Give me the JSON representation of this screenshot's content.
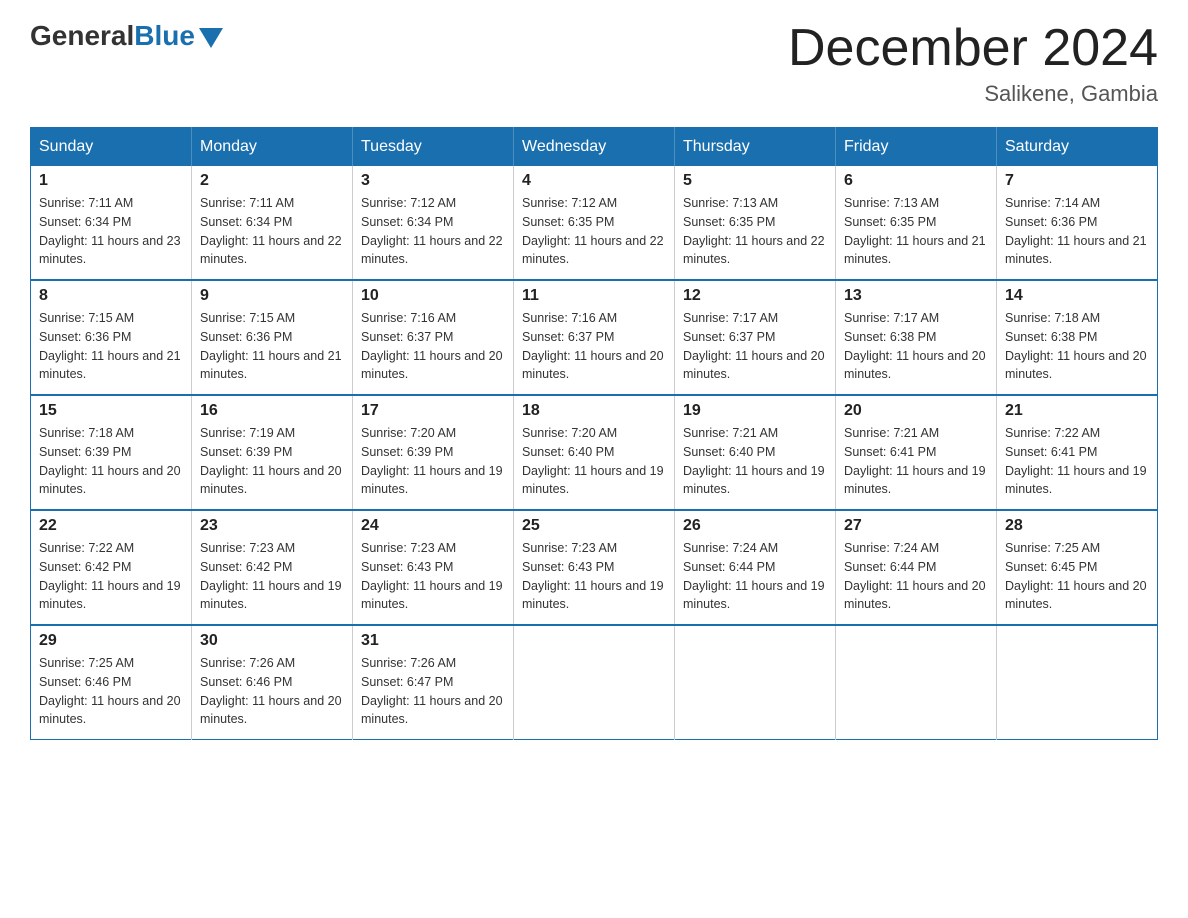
{
  "header": {
    "logo": {
      "general": "General",
      "blue": "Blue",
      "triangle": "▼"
    },
    "title": "December 2024",
    "location": "Salikene, Gambia"
  },
  "calendar": {
    "days_of_week": [
      "Sunday",
      "Monday",
      "Tuesday",
      "Wednesday",
      "Thursday",
      "Friday",
      "Saturday"
    ],
    "weeks": [
      [
        {
          "day": "1",
          "sunrise": "7:11 AM",
          "sunset": "6:34 PM",
          "daylight": "11 hours and 23 minutes."
        },
        {
          "day": "2",
          "sunrise": "7:11 AM",
          "sunset": "6:34 PM",
          "daylight": "11 hours and 22 minutes."
        },
        {
          "day": "3",
          "sunrise": "7:12 AM",
          "sunset": "6:34 PM",
          "daylight": "11 hours and 22 minutes."
        },
        {
          "day": "4",
          "sunrise": "7:12 AM",
          "sunset": "6:35 PM",
          "daylight": "11 hours and 22 minutes."
        },
        {
          "day": "5",
          "sunrise": "7:13 AM",
          "sunset": "6:35 PM",
          "daylight": "11 hours and 22 minutes."
        },
        {
          "day": "6",
          "sunrise": "7:13 AM",
          "sunset": "6:35 PM",
          "daylight": "11 hours and 21 minutes."
        },
        {
          "day": "7",
          "sunrise": "7:14 AM",
          "sunset": "6:36 PM",
          "daylight": "11 hours and 21 minutes."
        }
      ],
      [
        {
          "day": "8",
          "sunrise": "7:15 AM",
          "sunset": "6:36 PM",
          "daylight": "11 hours and 21 minutes."
        },
        {
          "day": "9",
          "sunrise": "7:15 AM",
          "sunset": "6:36 PM",
          "daylight": "11 hours and 21 minutes."
        },
        {
          "day": "10",
          "sunrise": "7:16 AM",
          "sunset": "6:37 PM",
          "daylight": "11 hours and 20 minutes."
        },
        {
          "day": "11",
          "sunrise": "7:16 AM",
          "sunset": "6:37 PM",
          "daylight": "11 hours and 20 minutes."
        },
        {
          "day": "12",
          "sunrise": "7:17 AM",
          "sunset": "6:37 PM",
          "daylight": "11 hours and 20 minutes."
        },
        {
          "day": "13",
          "sunrise": "7:17 AM",
          "sunset": "6:38 PM",
          "daylight": "11 hours and 20 minutes."
        },
        {
          "day": "14",
          "sunrise": "7:18 AM",
          "sunset": "6:38 PM",
          "daylight": "11 hours and 20 minutes."
        }
      ],
      [
        {
          "day": "15",
          "sunrise": "7:18 AM",
          "sunset": "6:39 PM",
          "daylight": "11 hours and 20 minutes."
        },
        {
          "day": "16",
          "sunrise": "7:19 AM",
          "sunset": "6:39 PM",
          "daylight": "11 hours and 20 minutes."
        },
        {
          "day": "17",
          "sunrise": "7:20 AM",
          "sunset": "6:39 PM",
          "daylight": "11 hours and 19 minutes."
        },
        {
          "day": "18",
          "sunrise": "7:20 AM",
          "sunset": "6:40 PM",
          "daylight": "11 hours and 19 minutes."
        },
        {
          "day": "19",
          "sunrise": "7:21 AM",
          "sunset": "6:40 PM",
          "daylight": "11 hours and 19 minutes."
        },
        {
          "day": "20",
          "sunrise": "7:21 AM",
          "sunset": "6:41 PM",
          "daylight": "11 hours and 19 minutes."
        },
        {
          "day": "21",
          "sunrise": "7:22 AM",
          "sunset": "6:41 PM",
          "daylight": "11 hours and 19 minutes."
        }
      ],
      [
        {
          "day": "22",
          "sunrise": "7:22 AM",
          "sunset": "6:42 PM",
          "daylight": "11 hours and 19 minutes."
        },
        {
          "day": "23",
          "sunrise": "7:23 AM",
          "sunset": "6:42 PM",
          "daylight": "11 hours and 19 minutes."
        },
        {
          "day": "24",
          "sunrise": "7:23 AM",
          "sunset": "6:43 PM",
          "daylight": "11 hours and 19 minutes."
        },
        {
          "day": "25",
          "sunrise": "7:23 AM",
          "sunset": "6:43 PM",
          "daylight": "11 hours and 19 minutes."
        },
        {
          "day": "26",
          "sunrise": "7:24 AM",
          "sunset": "6:44 PM",
          "daylight": "11 hours and 19 minutes."
        },
        {
          "day": "27",
          "sunrise": "7:24 AM",
          "sunset": "6:44 PM",
          "daylight": "11 hours and 20 minutes."
        },
        {
          "day": "28",
          "sunrise": "7:25 AM",
          "sunset": "6:45 PM",
          "daylight": "11 hours and 20 minutes."
        }
      ],
      [
        {
          "day": "29",
          "sunrise": "7:25 AM",
          "sunset": "6:46 PM",
          "daylight": "11 hours and 20 minutes."
        },
        {
          "day": "30",
          "sunrise": "7:26 AM",
          "sunset": "6:46 PM",
          "daylight": "11 hours and 20 minutes."
        },
        {
          "day": "31",
          "sunrise": "7:26 AM",
          "sunset": "6:47 PM",
          "daylight": "11 hours and 20 minutes."
        },
        null,
        null,
        null,
        null
      ]
    ]
  }
}
